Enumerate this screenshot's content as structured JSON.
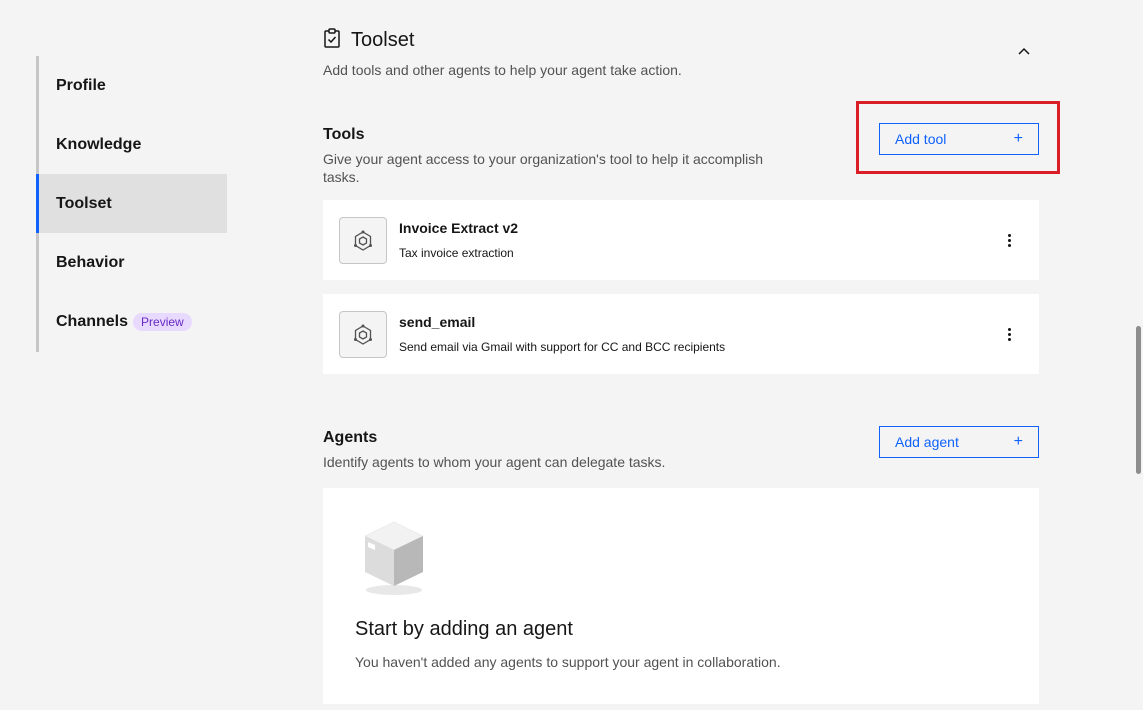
{
  "sidebar": {
    "items": [
      {
        "label": "Profile"
      },
      {
        "label": "Knowledge"
      },
      {
        "label": "Toolset"
      },
      {
        "label": "Behavior"
      },
      {
        "label": "Channels",
        "badge": "Preview"
      }
    ],
    "active": "Toolset"
  },
  "section": {
    "icon": "clipboard-check-icon",
    "title": "Toolset",
    "description": "Add tools and other agents to help your agent take action."
  },
  "tools": {
    "title": "Tools",
    "description": "Give your agent access to your organization's tool to help it accomplish tasks.",
    "add_button": "Add tool",
    "items": [
      {
        "name": "Invoice Extract v2",
        "description": "Tax invoice extraction",
        "icon": "tool-hex-icon"
      },
      {
        "name": "send_email",
        "description": "Send email via Gmail with support for CC and BCC recipients",
        "icon": "tool-hex-icon"
      }
    ]
  },
  "agents": {
    "title": "Agents",
    "description": "Identify agents to whom your agent can delegate tasks.",
    "add_button": "Add agent",
    "empty_title": "Start by adding an agent",
    "empty_description": "You haven't added any agents to support your agent in collaboration."
  },
  "colors": {
    "accent": "#0f62fe",
    "highlight": "#da1e28",
    "badge_bg": "#e8daff",
    "badge_text": "#6929c4"
  }
}
